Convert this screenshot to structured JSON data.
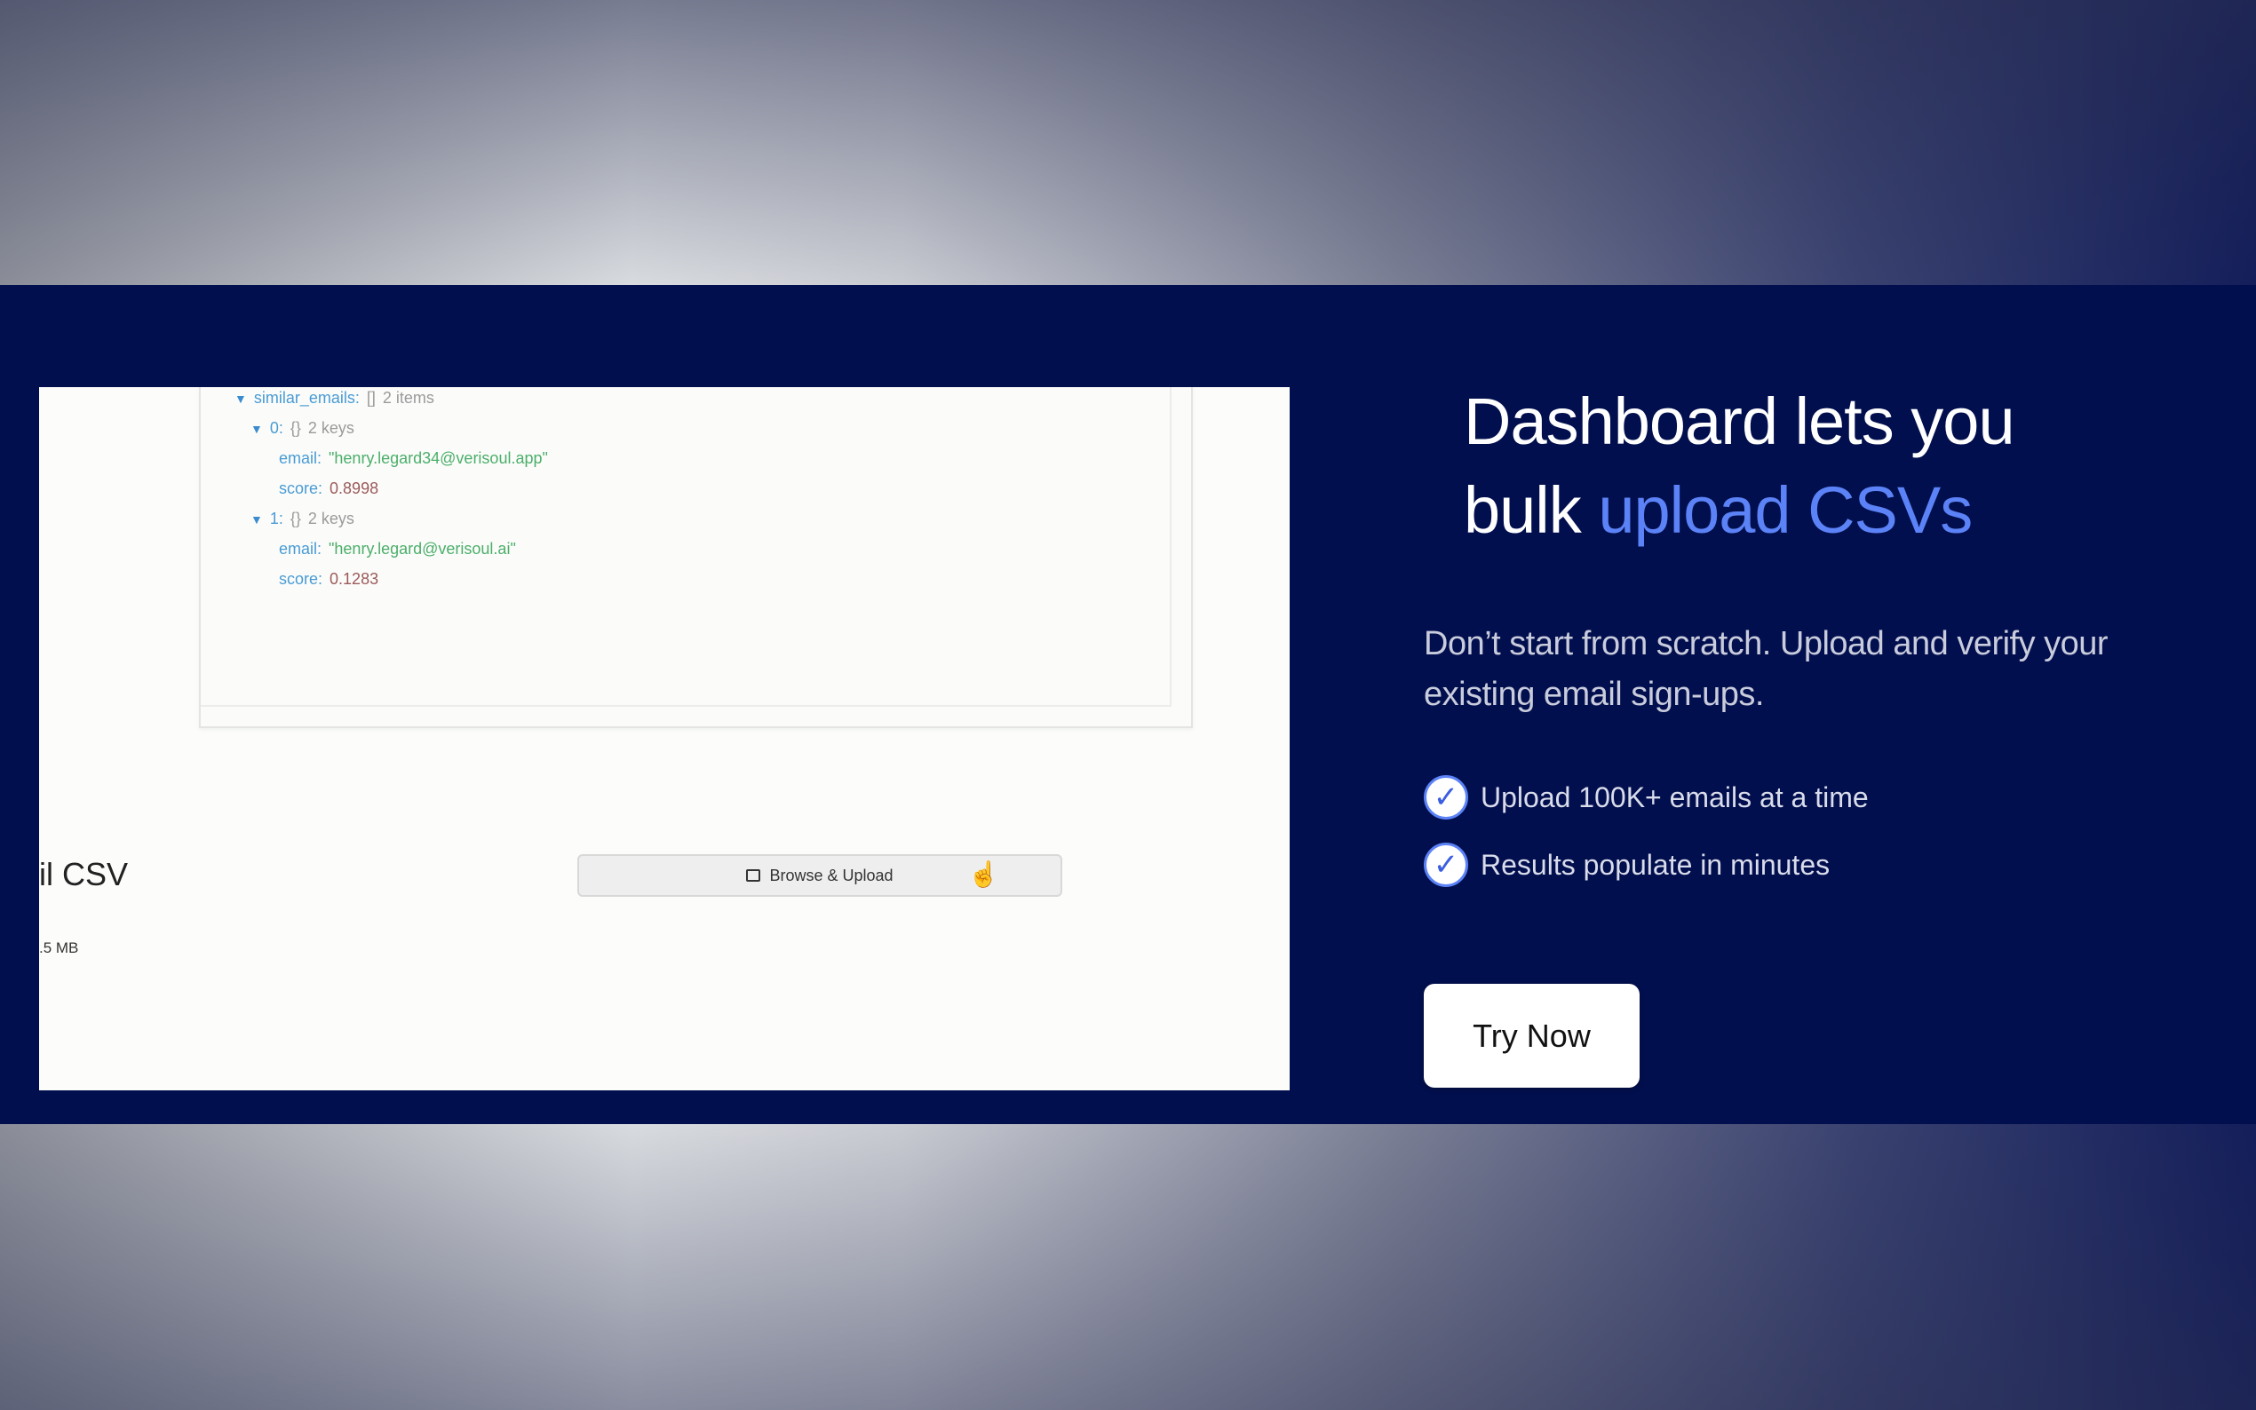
{
  "screenshot": {
    "json_view": {
      "root_key": "similar_emails:",
      "root_bracket": "[]",
      "root_count": "2 items",
      "entries": [
        {
          "index": "0:",
          "bracket": "{}",
          "count": "2 keys",
          "email_key": "email:",
          "email_value": "\"henry.legard34@verisoul.app\"",
          "score_key": "score:",
          "score_value": "0.8998"
        },
        {
          "index": "1:",
          "bracket": "{}",
          "count": "2 keys",
          "email_key": "email:",
          "email_value": "\"henry.legard@verisoul.ai\"",
          "score_key": "score:",
          "score_value": "0.1283"
        }
      ]
    },
    "csv_title": "il CSV",
    "csv_size": ".5 MB",
    "upload_button_label": "Browse & Upload"
  },
  "content": {
    "headline_line1": "Dashboard lets you",
    "headline_line2_plain": "bulk ",
    "headline_line2_accent": "upload CSVs",
    "subtext": "Don’t start from scratch. Upload and verify your existing email sign-ups.",
    "features": [
      "Upload 100K+ emails at a time",
      "Results populate in minutes"
    ],
    "cta_label": "Try Now"
  },
  "colors": {
    "band": "#020f4e",
    "accent": "#5b82f6"
  },
  "icons": [
    "upload-icon",
    "hand-cursor-icon",
    "check-icon"
  ]
}
